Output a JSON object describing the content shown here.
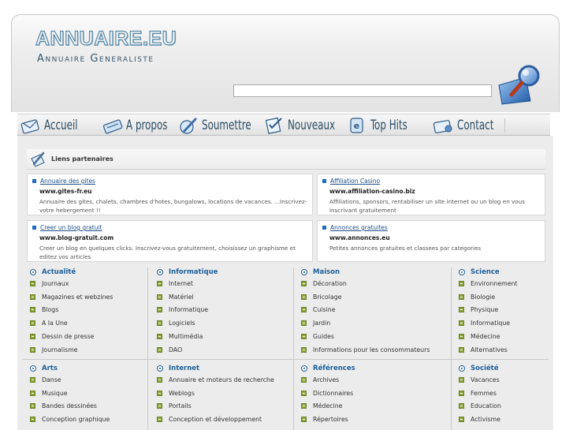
{
  "header": {
    "logo_text": "ANNUAIRE.EU",
    "tagline": "Annuaire Generaliste",
    "search_placeholder": "",
    "search_button_icon": "magnifier-icon"
  },
  "nav": {
    "items": [
      {
        "label": "Accueil",
        "icon": "home-envelope-icon"
      },
      {
        "label": "A propos",
        "icon": "keyboard-icon"
      },
      {
        "label": "Soumettre",
        "icon": "pen-icon"
      },
      {
        "label": "Nouveaux",
        "icon": "checklist-icon"
      },
      {
        "label": "Top Hits",
        "icon": "tag-icon"
      },
      {
        "label": "Contact",
        "icon": "mail-icon"
      }
    ]
  },
  "partners": {
    "title": "Liens partenaires",
    "cards": [
      {
        "title": "Annuaire des gites",
        "url": "www.gites-fr.eu",
        "desc": "Annuaire des gites, chalets, chambres d'hotes, bungalows, locations de vacances. ...Inscrivez-votre hebergement !!"
      },
      {
        "title": "Affiliation Casino",
        "url": "www.affiliation-casino.biz",
        "desc": "Affiliations, sponsors, rentabiliser un site internet ou un blog en vous inscrivant gratuitement"
      },
      {
        "title": "Creer un blog gratuit",
        "url": "www.blog-gratuit.com",
        "desc": "Creer un blog en quelques clicks. Inscrivez-vous gratuitement, choisissez un graphisme et editez vos articles"
      },
      {
        "title": "Annonces gratuites",
        "url": "www.annonces.eu",
        "desc": "Petites annonces gratuites et classees par categories"
      }
    ]
  },
  "categories": [
    {
      "title": "Actualité",
      "items": [
        "Journaux",
        "Magazines et webzines",
        "Blogs",
        "A la Une",
        "Dessin de presse",
        "Journalisme"
      ]
    },
    {
      "title": "Informatique",
      "items": [
        "Internet",
        "Matériel",
        "Informatique",
        "Logiciels",
        "Multimédia",
        "DAO"
      ]
    },
    {
      "title": "Maison",
      "items": [
        "Décoration",
        "Bricolage",
        "Cuisine",
        "Jardin",
        "Guides",
        "Informations pour les consommateurs"
      ]
    },
    {
      "title": "Science",
      "items": [
        "Environnement",
        "Biologie",
        "Physique",
        "Informatique",
        "Médecine",
        "Alternatives"
      ]
    },
    {
      "title": "Arts",
      "items": [
        "Danse",
        "Musique",
        "Bandes dessinées",
        "Conception graphique"
      ]
    },
    {
      "title": "Internet",
      "items": [
        "Annuaire et moteurs de recherche",
        "Weblogs",
        "Portails",
        "Conception et développement"
      ]
    },
    {
      "title": "Références",
      "items": [
        "Archives",
        "Dictionnaires",
        "Médecine",
        "Répertoires"
      ]
    },
    {
      "title": "Société",
      "items": [
        "Vacances",
        "Femmes",
        "Education",
        "Activisme"
      ]
    }
  ]
}
